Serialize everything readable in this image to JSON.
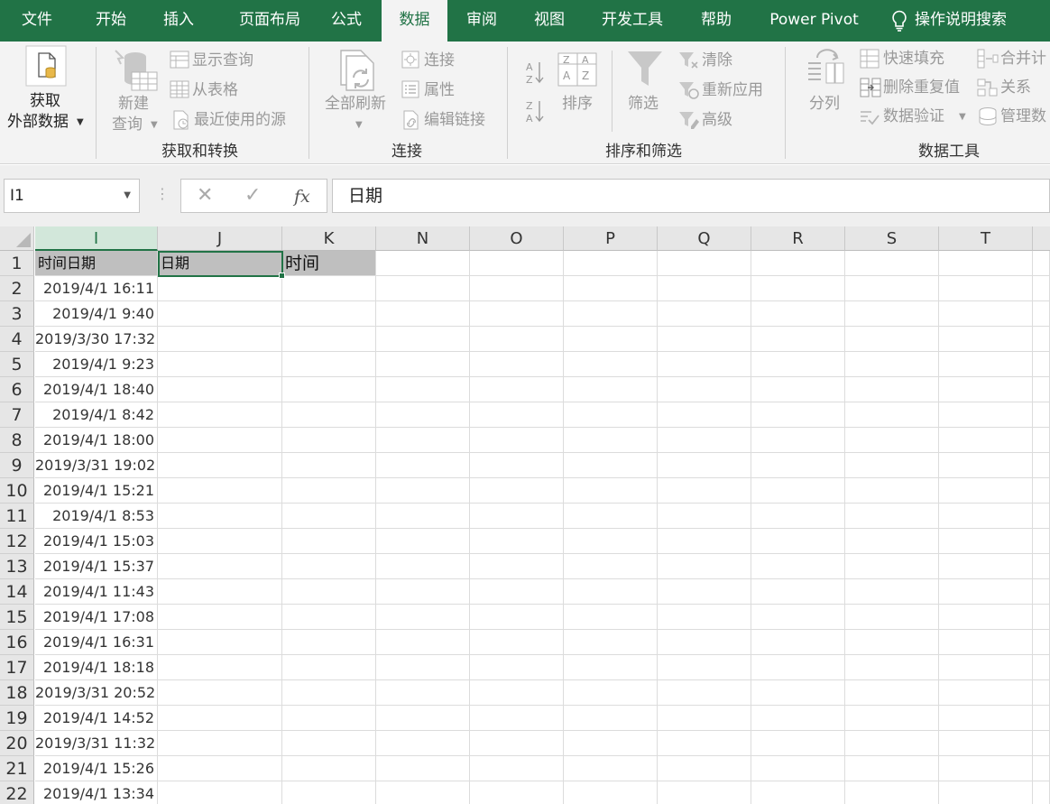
{
  "menu": {
    "tabs": [
      "文件",
      "开始",
      "插入",
      "页面布局",
      "公式",
      "数据",
      "审阅",
      "视图",
      "开发工具",
      "帮助",
      "Power Pivot"
    ],
    "active": "数据",
    "search": "操作说明搜索"
  },
  "ribbon": {
    "get_external": {
      "line1": "获取",
      "line2": "外部数据"
    },
    "new_query": {
      "line1": "新建",
      "line2": "查询"
    },
    "show_queries": "显示查询",
    "from_table": "从表格",
    "recent_sources": "最近使用的源",
    "group_get_transform": "获取和转换",
    "refresh_all": "全部刷新",
    "connections": "连接",
    "properties": "属性",
    "edit_links": "编辑链接",
    "group_connections": "连接",
    "sort": "排序",
    "filter": "筛选",
    "clear": "清除",
    "reapply": "重新应用",
    "advanced": "高级",
    "group_sort_filter": "排序和筛选",
    "text_to_columns": "分列",
    "flash_fill": "快速填充",
    "remove_duplicates": "删除重复值",
    "data_validation": "数据验证",
    "consolidate": "合并计",
    "relationships": "关系",
    "manage_data_model": "管理数",
    "group_data_tools": "数据工具"
  },
  "formula_bar": {
    "name_box": "I1",
    "cancel": "✕",
    "enter": "✓",
    "fx": "fx",
    "content": "日期"
  },
  "columns": [
    "I",
    "J",
    "K",
    "N",
    "O",
    "P",
    "Q",
    "R",
    "S",
    "T"
  ],
  "header_row": {
    "I": "时间日期",
    "J": "日期",
    "K": "时间"
  },
  "rows": [
    "1",
    "2",
    "3",
    "4",
    "5",
    "6",
    "7",
    "8",
    "9",
    "10",
    "11",
    "12",
    "13",
    "14",
    "15",
    "16",
    "17",
    "18",
    "19",
    "20",
    "21",
    "22"
  ],
  "datetimes": [
    "2019/4/1 16:11",
    "2019/4/1 9:40",
    "2019/3/30 17:32",
    "2019/4/1 9:23",
    "2019/4/1 18:40",
    "2019/4/1 8:42",
    "2019/4/1 18:00",
    "2019/3/31 19:02",
    "2019/4/1 15:21",
    "2019/4/1 8:53",
    "2019/4/1 15:03",
    "2019/4/1 15:37",
    "2019/4/1 11:43",
    "2019/4/1 17:08",
    "2019/4/1 16:31",
    "2019/4/1 18:18",
    "2019/3/31 20:52",
    "2019/4/1 14:52",
    "2019/3/31 11:32",
    "2019/4/1 15:26",
    "2019/4/1 13:34"
  ],
  "colors": {
    "accent": "#217346"
  }
}
